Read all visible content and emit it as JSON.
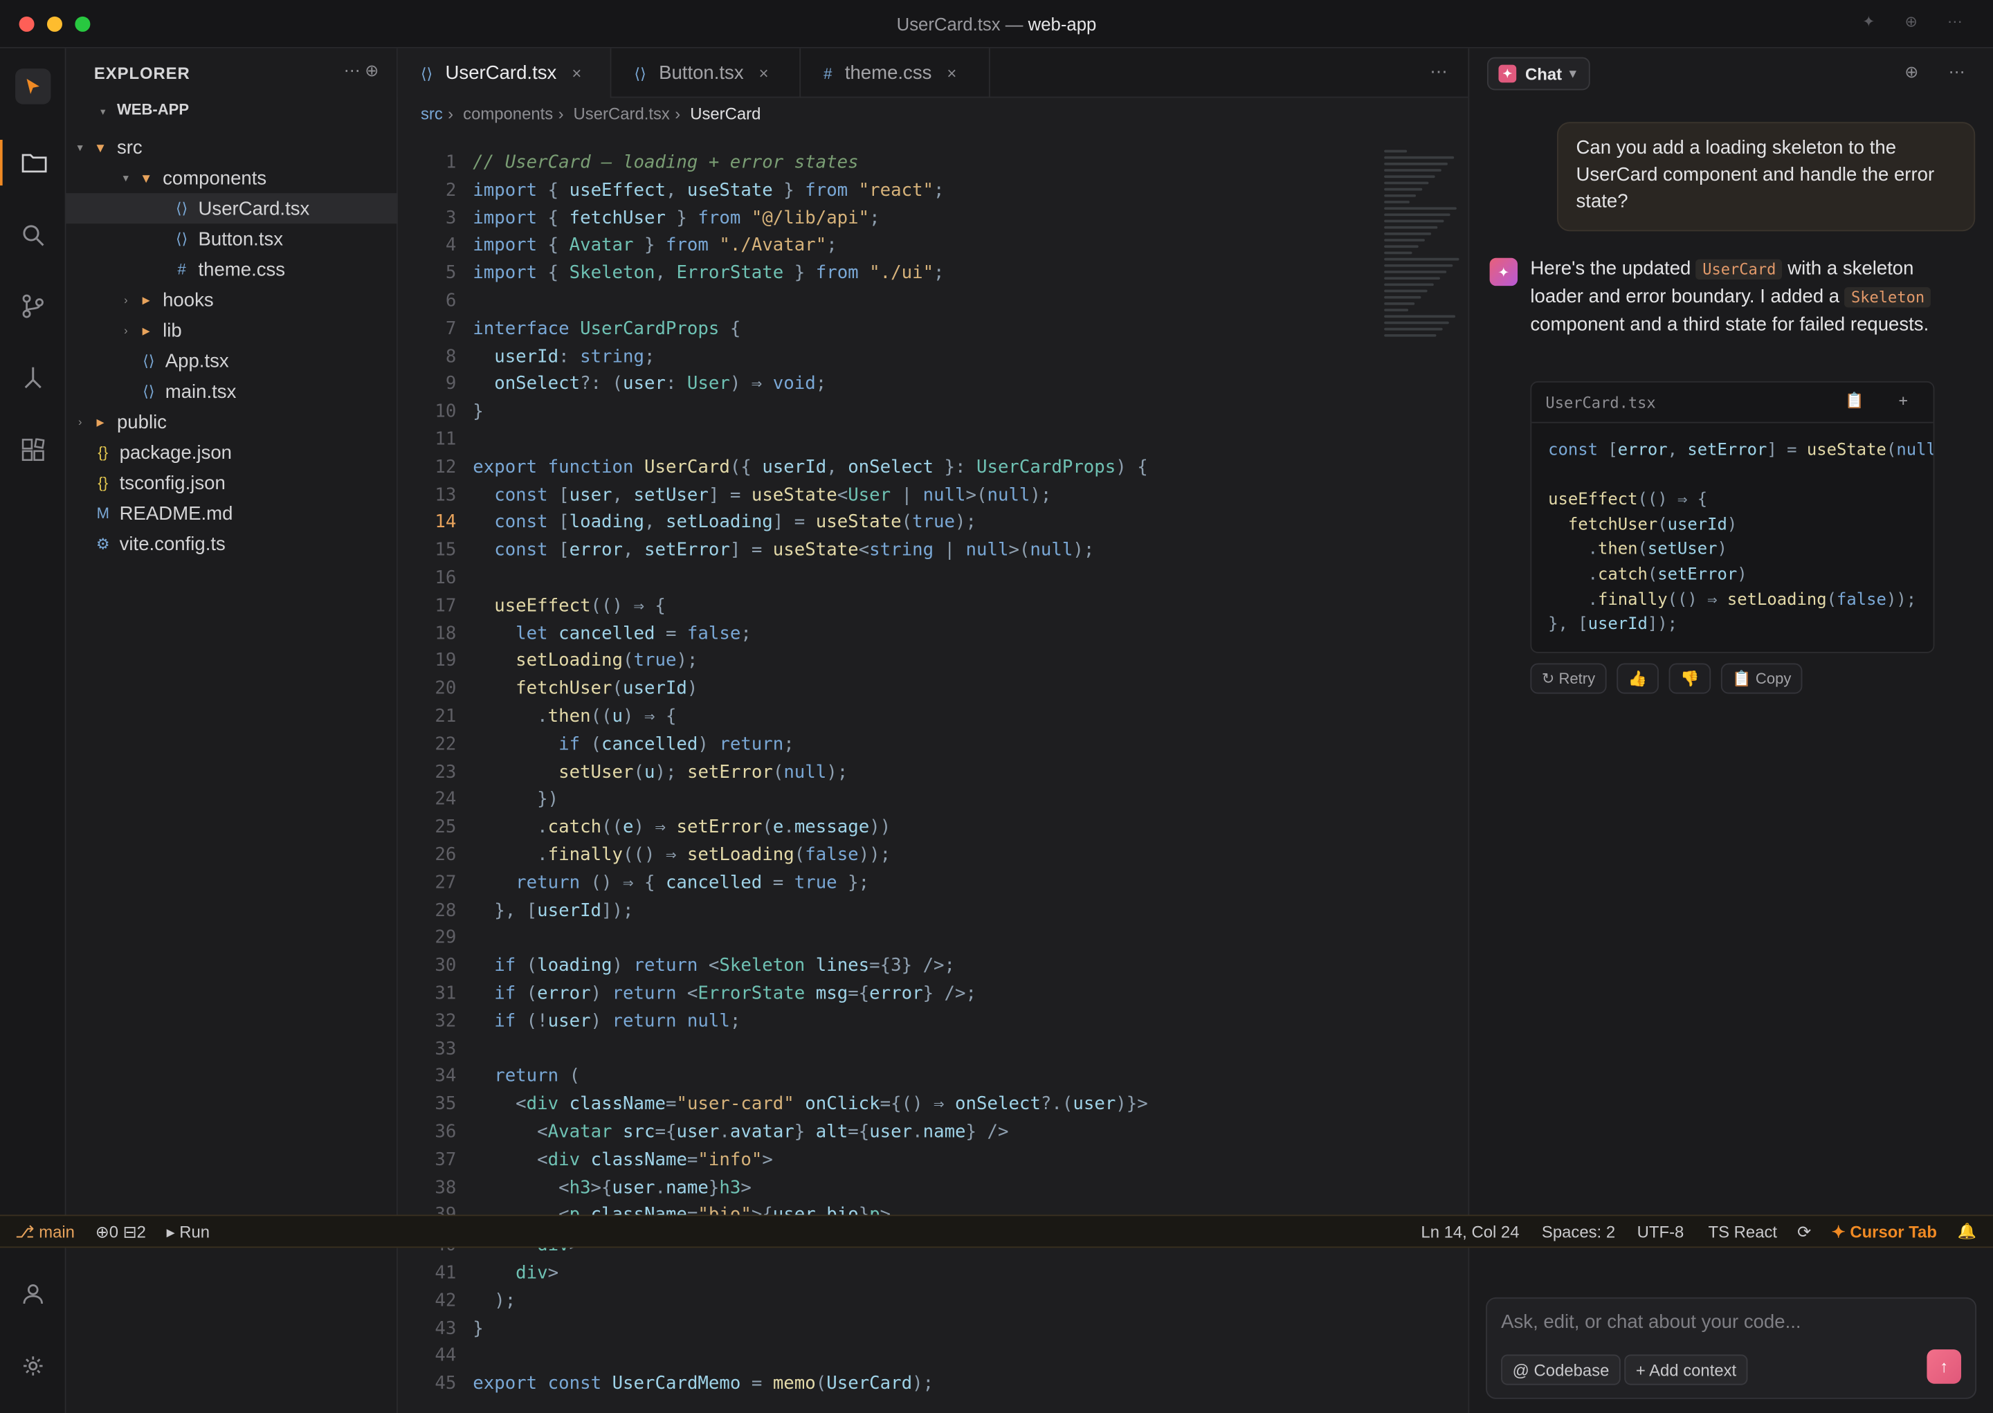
{
  "window": {
    "title_file": "UserCard.tsx",
    "title_sep": " — ",
    "title_project": "web-app",
    "right_icons": "✦ ⊕ ⋯"
  },
  "explorer": {
    "header": "EXPLORER",
    "actions": "⋯ ⊕",
    "root": "WEB-APP",
    "items": [
      {
        "label": "src",
        "icon": "folder-icon",
        "glyph": "▾"
      },
      {
        "label": "components",
        "icon": "folder-icon",
        "glyph": "▾"
      },
      {
        "label": "UserCard.tsx",
        "icon": "tsx-icon",
        "glyph": "⟨⟩"
      },
      {
        "label": "Button.tsx",
        "icon": "tsx-icon",
        "glyph": "⟨⟩"
      },
      {
        "label": "theme.css",
        "icon": "css-icon",
        "glyph": "#"
      },
      {
        "label": "hooks",
        "icon": "folder-icon",
        "glyph": "▸"
      },
      {
        "label": "lib",
        "icon": "folder-icon",
        "glyph": "▸"
      },
      {
        "label": "App.tsx",
        "icon": "tsx-icon",
        "glyph": "⟨⟩"
      },
      {
        "label": "main.tsx",
        "icon": "tsx-icon",
        "glyph": "⟨⟩"
      },
      {
        "label": "public",
        "icon": "folder-icon",
        "glyph": "▸"
      },
      {
        "label": "package.json",
        "icon": "json-icon",
        "glyph": "{}"
      },
      {
        "label": "tsconfig.json",
        "icon": "json-icon",
        "glyph": "{}"
      },
      {
        "label": "README.md",
        "icon": "markdown-icon",
        "glyph": "M"
      },
      {
        "label": "vite.config.ts",
        "icon": "config-icon",
        "glyph": "⚙"
      }
    ]
  },
  "tabs": [
    {
      "label": "UserCard.tsx",
      "glyph": "⟨⟩",
      "close": "×"
    },
    {
      "label": "Button.tsx",
      "glyph": "⟨⟩",
      "close": "×"
    },
    {
      "label": "theme.css",
      "glyph": "#",
      "close": "×"
    }
  ],
  "breadcrumb": [
    "src",
    "components",
    "UserCard.tsx",
    "UserCard"
  ],
  "breadcrumb_sep": "›",
  "code_lines": [
    "// UserCard — loading + error states",
    "import { useEffect, useState } from \"react\";",
    "import { fetchUser } from \"@/lib/api\";",
    "import { Avatar } from \"./Avatar\";",
    "import { Skeleton, ErrorState } from \"./ui\";",
    "",
    "interface UserCardProps {",
    "  userId: string;",
    "  onSelect?: (user: User) ⇒ void;",
    "}",
    "",
    "export function UserCard({ userId, onSelect }: UserCardProps) {",
    "  const [user, setUser] = useState<User | null>(null);",
    "  const [loading, setLoading] = useState(true);",
    "  const [error, setError] = useState<string | null>(null);",
    "",
    "  useEffect(() ⇒ {",
    "    let cancelled = false;",
    "    setLoading(true);",
    "    fetchUser(userId)",
    "      .then((u) ⇒ {",
    "        if (cancelled) return;",
    "        setUser(u); setError(null);",
    "      })",
    "      .catch((e) ⇒ setError(e.message))",
    "      .finally(() ⇒ setLoading(false));",
    "    return () ⇒ { cancelled = true };",
    "  }, [userId]);",
    "",
    "  if (loading) return <Skeleton lines={3} />;",
    "  if (error) return <ErrorState msg={error} />;",
    "  if (!user) return null;",
    "",
    "  return (",
    "    <div className=\"user-card\" onClick={() ⇒ onSelect?.(user)}>",
    "      <Avatar src={user.avatar} alt={user.name} />",
    "      <div className=\"info\">",
    "        <h3>{user.name}h3>",
    "        <p className=\"bio\">{user.bio}p>",
    "      div>",
    "    div>",
    "  );",
    "}",
    "",
    "export const UserCardMemo = memo(UserCard);"
  ],
  "current_line": 14,
  "status": {
    "branch": "⎇ main",
    "problems": "⊕0 ⊟2",
    "run": "▸ Run",
    "position": "Ln 14, Col 24",
    "spaces": "Spaces: 2",
    "encoding": "UTF-8",
    "language": "TS React",
    "sync": "⟳",
    "cursor_tab": "✦ Cursor Tab",
    "bell": "🔔"
  },
  "chat": {
    "tab_label": "Chat",
    "tab_caret": "▾",
    "icons": "⊕ ⋯",
    "user_message": "Can you add a loading skeleton to the UserCard component and handle the error state?",
    "ai_intro_1": "Here's the updated",
    "ai_code_1": "UserCard",
    "ai_intro_2": "with a skeleton loader and error boundary. I added a",
    "ai_code_2": "Skeleton",
    "ai_intro_3": "component and a third state for failed requests.",
    "codeblock_file": "UserCard.tsx",
    "codeblock_actions": "📋 +",
    "codeblock_lines": [
      "const [error, setError] = useState(null)",
      "",
      "useEffect(() ⇒ {",
      "  fetchUser(userId)",
      "    .then(setUser)",
      "    .catch(setError)",
      "    .finally(() ⇒ setLoading(false));",
      "}, [userId]);"
    ],
    "buttons": {
      "retry": "↻ Retry",
      "up": "👍",
      "down": "👎",
      "copy": "📋 Copy"
    },
    "composer_placeholder": "Ask, edit, or chat about your code...",
    "chip_codebase": "@ Codebase",
    "chip_context": "+ Add context",
    "send": "↑"
  },
  "colors": {
    "accent": "#f08a24",
    "cursor_tab": "#f08a24",
    "send": "#e0587a"
  }
}
